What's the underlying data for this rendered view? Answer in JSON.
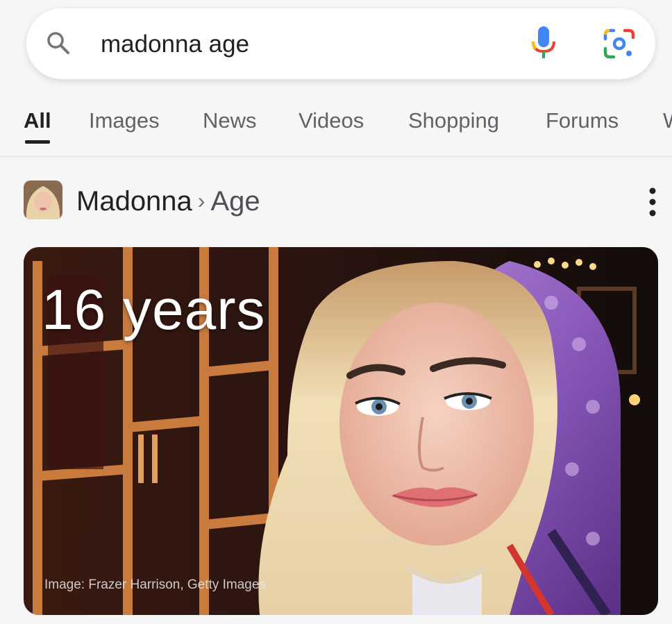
{
  "search": {
    "query": "madonna age",
    "icons": {
      "search": "search-icon",
      "mic": "mic-icon",
      "lens": "lens-icon"
    }
  },
  "tabs": [
    {
      "label": "All",
      "active": true
    },
    {
      "label": "Images"
    },
    {
      "label": "News"
    },
    {
      "label": "Videos"
    },
    {
      "label": "Shopping"
    },
    {
      "label": "Forums"
    },
    {
      "label": "W"
    }
  ],
  "result": {
    "entity": "Madonna",
    "attribute": "Age",
    "separator": "›",
    "value": "16 years",
    "image_credit": "Image: Frazer Harrison, Getty Images"
  },
  "colors": {
    "accent_blue": "#4285f4",
    "accent_red": "#ea4335",
    "accent_yellow": "#fbbc05",
    "accent_green": "#34a853"
  }
}
